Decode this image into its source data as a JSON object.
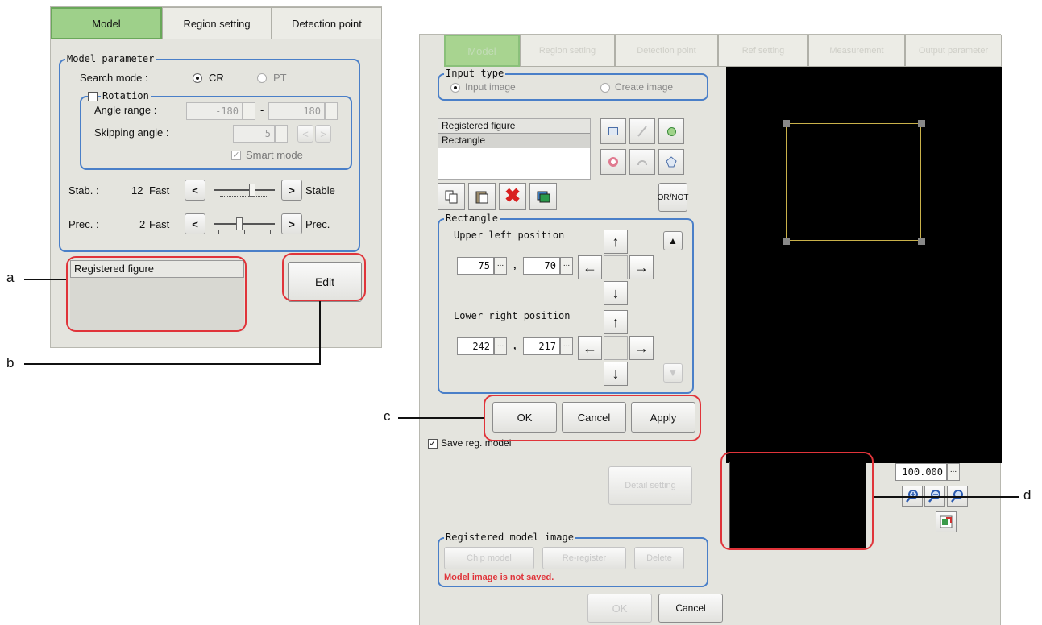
{
  "left_tabs": [
    "Model",
    "Region setting",
    "Detection point"
  ],
  "model_parameter": {
    "title": "Model parameter",
    "search_mode_label": "Search mode :",
    "search_cr": "CR",
    "search_pt": "PT",
    "rotation_label": "Rotation",
    "angle_range_label": "Angle range :",
    "angle_min": "-180",
    "angle_max": "180",
    "angle_sep": "-",
    "skipping_label": "Skipping angle :",
    "skipping_value": "5",
    "smart_mode_label": "Smart mode",
    "stab_label": "Stab. :",
    "stab_value": "12",
    "stab_fast": "Fast",
    "stab_stable": "Stable",
    "prec_label": "Prec. :",
    "prec_value": "2",
    "prec_fast": "Fast",
    "prec_prec": "Prec.",
    "less": "<",
    "more": ">"
  },
  "left_registered_figure": "Registered figure",
  "edit_button": "Edit",
  "right_tabs": [
    "Model",
    "Region setting",
    "Detection point",
    "Ref setting",
    "Measurement",
    "Output parameter"
  ],
  "input_type": {
    "title": "Input type",
    "input_image": "Input image",
    "create_image": "Create image"
  },
  "figure_list": {
    "header": "Registered figure",
    "items": [
      "Rectangle"
    ]
  },
  "ornot_label": "OR/NOT",
  "rectangle": {
    "title": "Rectangle",
    "upper_left_label": "Upper left position",
    "ul_x": "75",
    "ul_y": "70",
    "lower_right_label": "Lower right position",
    "lr_x": "242",
    "lr_y": "217",
    "comma": ",",
    "dots": "..."
  },
  "dialog_buttons": {
    "ok": "OK",
    "cancel": "Cancel",
    "apply": "Apply"
  },
  "save_reg_model": "Save reg. model",
  "detail_setting": "Detail setting",
  "registered_model_image": {
    "title": "Registered model image",
    "buttons": [
      "Chip model",
      "Re-register",
      "Delete"
    ],
    "warning": "Model image is not saved.",
    "warning_color": "#e0343a"
  },
  "bottom_buttons": {
    "ok": "OK",
    "cancel": "Cancel"
  },
  "zoom_value": "100.000",
  "callouts": {
    "a": "a",
    "b": "b",
    "c": "c",
    "d": "d"
  },
  "colors": {
    "accent_tab": "#9ed08a",
    "group_border": "#4a7fc8",
    "callout_outline": "#e0343a"
  },
  "icons": {
    "copy": "copy-icon",
    "paste": "paste-icon",
    "delete": "delete-icon",
    "image": "image-icon",
    "rectangle": "rectangle-shape-icon",
    "line": "line-shape-icon",
    "circle": "circle-shape-icon",
    "ring": "ring-shape-icon",
    "arc": "arc-shape-icon",
    "polygon": "polygon-shape-icon",
    "zoom_in": "zoom-in-icon",
    "zoom_out": "zoom-out-icon",
    "zoom_fit": "zoom-fit-icon",
    "fit_window": "fit-window-icon"
  }
}
